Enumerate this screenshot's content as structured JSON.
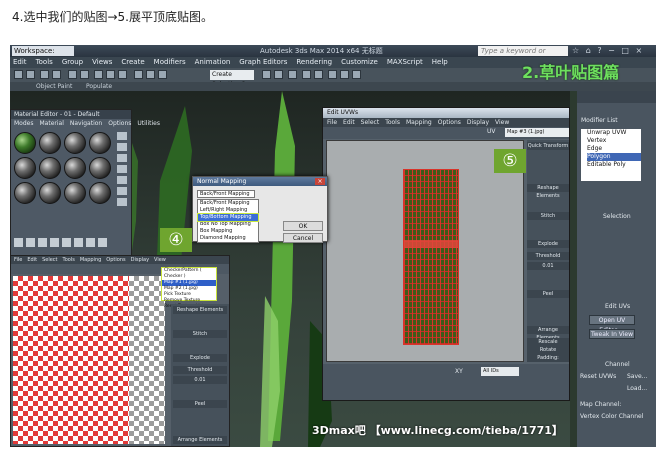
{
  "caption": "4.选中我们的贴图→5.展平顶底贴图。",
  "window": {
    "workspace": "Workspace: Default",
    "title": "Autodesk 3ds Max 2014 x64    无标题",
    "search_placeholder": "Type a keyword or phrase",
    "controls": "☆ ⌂ ? − □ ×"
  },
  "menubar": [
    "Edit",
    "Tools",
    "Group",
    "Views",
    "Create",
    "Modifiers",
    "Animation",
    "Graph Editors",
    "Rendering",
    "Customize",
    "MAXScript",
    "Help"
  ],
  "toolbar": {
    "selection_set": "Create Selection Se"
  },
  "subbar": {
    "object_paint": "Object Paint",
    "populate": "Populate"
  },
  "brand_title": "2.草叶贴图篇",
  "material_editor": {
    "title": "Material Editor - 01 - Default",
    "menu": [
      "Modes",
      "Material",
      "Navigation",
      "Options",
      "Utilities"
    ]
  },
  "dialog": {
    "title": "Normal Mapping",
    "close": "×",
    "selected": "Back/Front Mapping",
    "options": [
      "Back/Front Mapping",
      "Left/Right Mapping",
      "Top/Bottom Mapping",
      "Box No Top Mapping",
      "Box Mapping",
      "Diamond Mapping"
    ],
    "highlighted_index": 2,
    "ok": "OK",
    "cancel": "Cancel"
  },
  "badges": {
    "step4": "④",
    "step5": "⑤"
  },
  "uv_left": {
    "menu": [
      "File",
      "Edit",
      "Select",
      "Tools",
      "Mapping",
      "Options",
      "Display",
      "View"
    ],
    "pattern_options": [
      "CheckerPattern ( Checker )",
      "Map #1 (1.jpg)",
      "Map #2 (1.jpg)",
      "Pick Texture",
      "Remove Texture",
      "Reset Texture List"
    ],
    "panels": [
      "Reshape Elements",
      "Stitch",
      "Explode",
      "Threshold",
      "Peel",
      "Arrange Elements"
    ],
    "threshold_value": "0.01"
  },
  "uv_right": {
    "title": "Edit UVWs",
    "menu": [
      "File",
      "Edit",
      "Select",
      "Tools",
      "Mapping",
      "Options",
      "Display",
      "View"
    ],
    "map_select": "Map #3 (1.jpg)",
    "uv_label": "UV",
    "panels": [
      "Quick Transform",
      "Reshape Elements",
      "Stitch",
      "Explode",
      "Threshold",
      "Peel",
      "Arrange Elements"
    ],
    "threshold_value": "0.01",
    "rescale": "Rescale",
    "rotate": "Rotate",
    "padding": "Padding:",
    "all_ids": "All IDs",
    "xy": "XY"
  },
  "command_panel": {
    "modifier_list": "Modifier List",
    "items": [
      "Unwrap UVW",
      "Vertex",
      "Edge",
      "Polygon",
      "Editable Poly"
    ],
    "selected_index": 3,
    "selection": "Selection",
    "edit_uvs": "Edit UVs",
    "open_uv_editor": "Open UV Editor ...",
    "tweak_in_view": "Tweak In View",
    "channel": "Channel",
    "reset_uvws": "Reset UVWs",
    "save": "Save...",
    "load": "Load...",
    "map_channel": "Map Channel:",
    "vertex_color_channel": "Vertex Color Channel"
  },
  "footer": "3Dmax吧 【www.linecg.com/tieba/1771】",
  "colors": {
    "brand_green": "#6ee05e",
    "badge_green": "#6fa52f",
    "highlight_yellow": "#c8e83b",
    "checker_red": "#e23a3a"
  }
}
